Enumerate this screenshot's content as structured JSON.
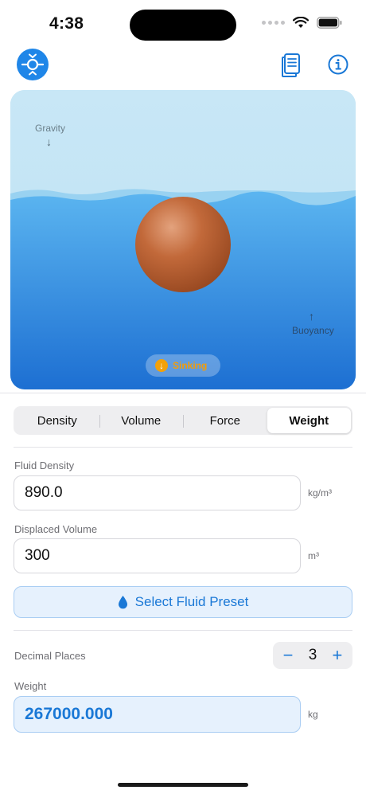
{
  "status_bar": {
    "time": "4:38"
  },
  "simulation": {
    "gravity_label": "Gravity",
    "buoyancy_label": "Buoyancy",
    "status": "Sinking",
    "status_color": "#f29d0a"
  },
  "tabs": [
    {
      "label": "Density"
    },
    {
      "label": "Volume"
    },
    {
      "label": "Force"
    },
    {
      "label": "Weight",
      "selected": true
    }
  ],
  "fields": {
    "fluid_density": {
      "label": "Fluid Density",
      "value": "890.0",
      "unit": "kg/m³"
    },
    "displaced_volume": {
      "label": "Displaced Volume",
      "value": "300",
      "unit": "m³"
    }
  },
  "preset_button": {
    "label": "Select Fluid Preset",
    "icon": "drop-icon"
  },
  "decimal_places": {
    "label": "Decimal Places",
    "value": "3",
    "decrement": "−",
    "increment": "+"
  },
  "result": {
    "label": "Weight",
    "value": "267000.000",
    "unit": "kg"
  },
  "colors": {
    "accent": "#1a78d6",
    "water": "#2f8ee4",
    "sphere": "#b85a2a"
  }
}
